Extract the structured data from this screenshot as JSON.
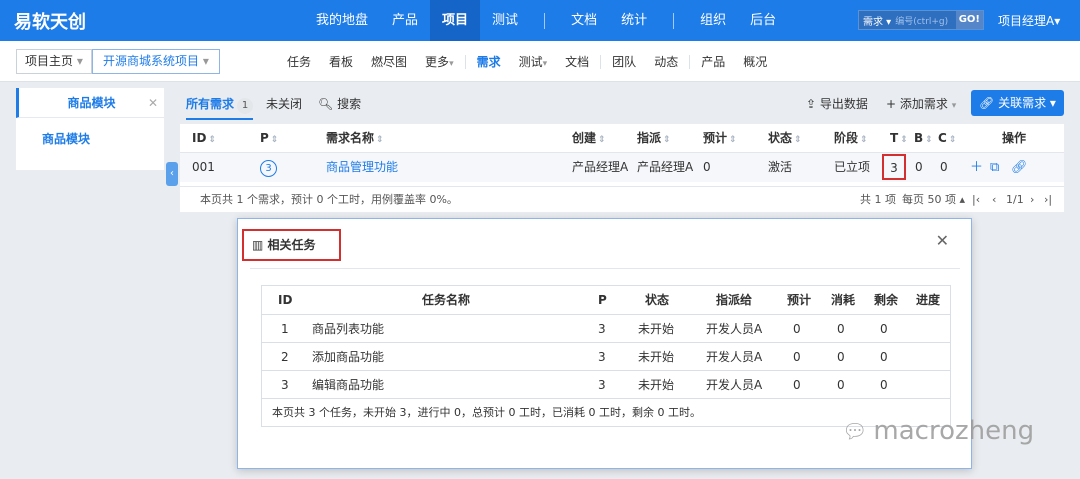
{
  "brand": "易软天创",
  "topnav": [
    "我的地盘",
    "产品",
    "项目",
    "测试",
    "文档",
    "统计",
    "组织",
    "后台"
  ],
  "search": {
    "type": "需求",
    "placeholder": "编号(ctrl+g)",
    "go": "GO!"
  },
  "user": "项目经理A",
  "crumb": {
    "home": "项目主页",
    "project": "开源商城系统项目"
  },
  "subnav": [
    "任务",
    "看板",
    "燃尽图",
    "更多",
    "需求",
    "测试",
    "文档",
    "团队",
    "动态",
    "产品",
    "概况"
  ],
  "sidebar": {
    "header": "商品模块",
    "item": "商品模块"
  },
  "tabs": {
    "all": "所有需求",
    "all_count": "1",
    "unclosed": "未关闭",
    "search": "搜索"
  },
  "tools": {
    "export": "导出数据",
    "add": "添加需求",
    "link": "关联需求"
  },
  "grid": {
    "headers": [
      "ID",
      "P",
      "需求名称",
      "创建",
      "指派",
      "预计",
      "状态",
      "阶段",
      "T",
      "B",
      "C",
      "操作"
    ],
    "row": {
      "id": "001",
      "p": "3",
      "name": "商品管理功能",
      "creator": "产品经理A",
      "assignee": "产品经理A",
      "estimate": "0",
      "status": "激活",
      "stage": "已立项",
      "t": "3",
      "b": "0",
      "c": "0"
    },
    "footer": "本页共 1 个需求，预计 0 个工时，用例覆盖率 0%。",
    "pager": {
      "total": "共 1 项",
      "per": "每页 50 项",
      "page": "1/1"
    }
  },
  "modal": {
    "title": "相关任务",
    "headers": [
      "ID",
      "任务名称",
      "P",
      "状态",
      "指派给",
      "预计",
      "消耗",
      "剩余",
      "进度"
    ],
    "rows": [
      {
        "id": "1",
        "name": "商品列表功能",
        "p": "3",
        "status": "未开始",
        "assignee": "开发人员A",
        "est": "0",
        "used": "0",
        "left": "0"
      },
      {
        "id": "2",
        "name": "添加商品功能",
        "p": "3",
        "status": "未开始",
        "assignee": "开发人员A",
        "est": "0",
        "used": "0",
        "left": "0"
      },
      {
        "id": "3",
        "name": "编辑商品功能",
        "p": "3",
        "status": "未开始",
        "assignee": "开发人员A",
        "est": "0",
        "used": "0",
        "left": "0"
      }
    ],
    "footer": "本页共 3 个任务，未开始 3，进行中 0，总预计 0 工时，已消耗 0 工时，剩余 0 工时。"
  },
  "watermark": "macrozheng"
}
